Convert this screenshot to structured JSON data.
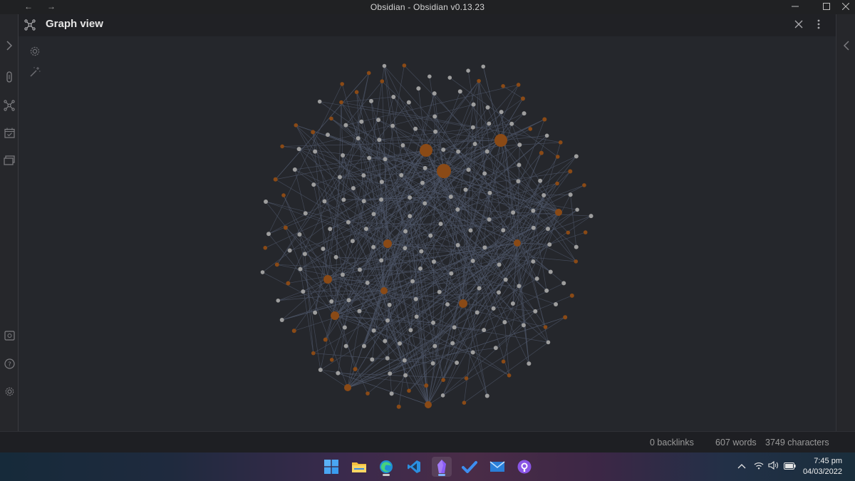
{
  "window": {
    "title": "Obsidian - Obsidian v0.13.23",
    "back_glyph": "←",
    "forward_glyph": "→"
  },
  "pane": {
    "title": "Graph view"
  },
  "status": {
    "backlinks": "0 backlinks",
    "words": "607 words",
    "characters": "3749 characters"
  },
  "taskbar": {
    "time": "7:45 pm",
    "date": "04/03/2022",
    "apps": [
      "windows-start",
      "file-explorer",
      "edge",
      "vscode",
      "obsidian",
      "todo",
      "mail",
      "github-desktop"
    ]
  },
  "colors": {
    "node": "#9e9e9e",
    "hub_node": "#8a4a16",
    "edge": "#4e5568",
    "accent": "#a47cf5"
  }
}
